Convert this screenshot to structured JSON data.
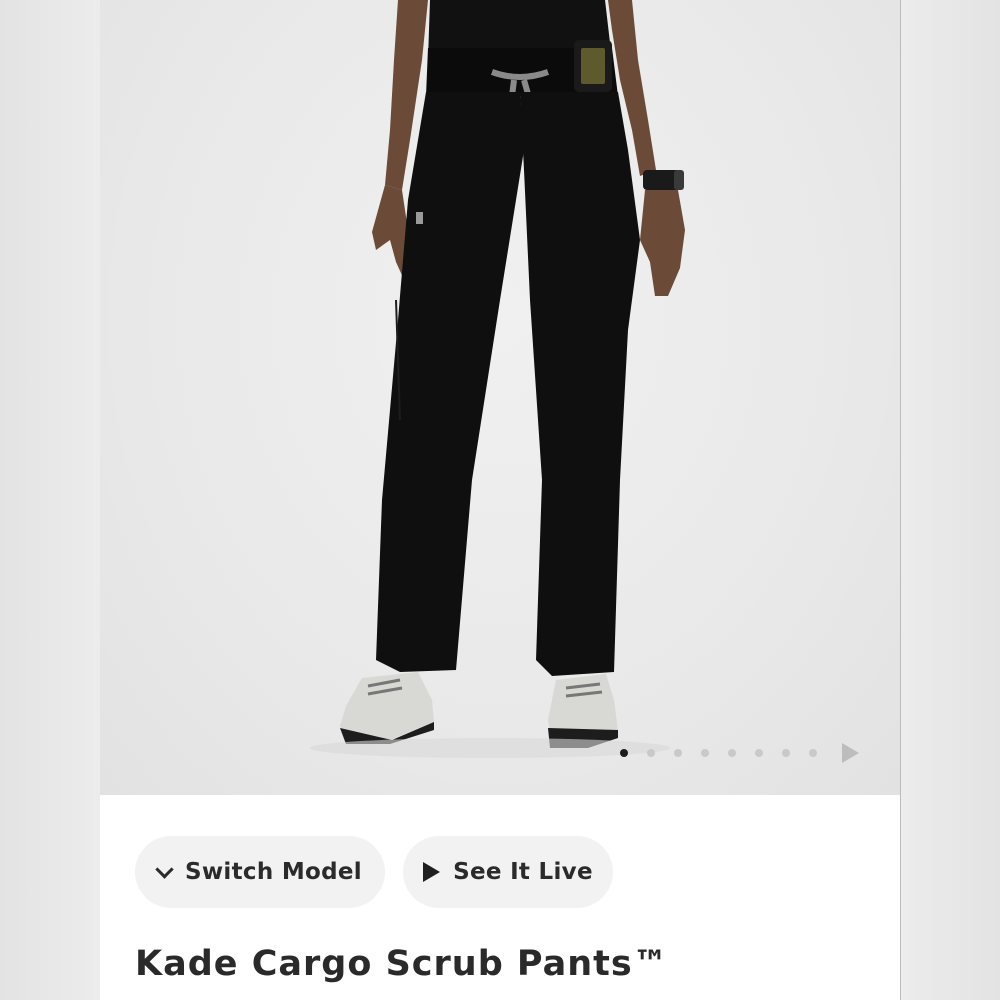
{
  "product": {
    "image": {
      "alt_icon": "product-photo-scrub-pants",
      "carousel": {
        "total_dots": 8,
        "active_index": 0
      }
    },
    "buttons": {
      "switch_model_label": "Switch Model",
      "see_it_live_label": "See It Live"
    },
    "title": "Kade Cargo Scrub Pants™"
  },
  "colors": {
    "accent_dark": "#1c1c1c",
    "pill_bg": "#f2f2f2",
    "pants": "#0f0f0f",
    "drawstring": "#8a8a8a"
  }
}
